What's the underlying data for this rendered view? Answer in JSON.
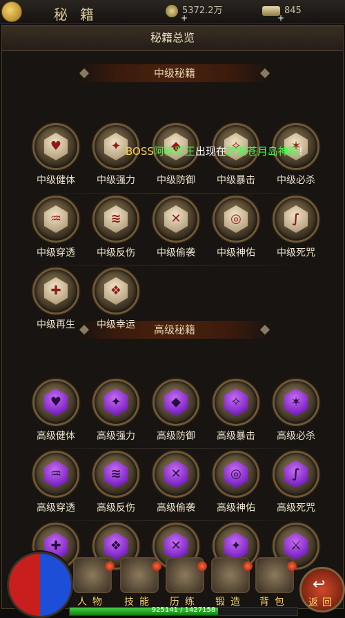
{
  "topbar": {
    "title": "秘籍",
    "gold": "5372.2万",
    "ingot": "845",
    "plus": "+"
  },
  "panel": {
    "header": "秘籍总览"
  },
  "sections": {
    "mid": "中级秘籍",
    "adv": "高级秘籍"
  },
  "mid_items": [
    {
      "label": "中级健体",
      "glyph": "♥"
    },
    {
      "label": "中级强力",
      "glyph": "✦"
    },
    {
      "label": "中级防御",
      "glyph": "◆"
    },
    {
      "label": "中级暴击",
      "glyph": "✧"
    },
    {
      "label": "中级必杀",
      "glyph": "✶"
    },
    {
      "label": "中级穿透",
      "glyph": "♒"
    },
    {
      "label": "中级反伤",
      "glyph": "≋"
    },
    {
      "label": "中级偷袭",
      "glyph": "✕"
    },
    {
      "label": "中级神佑",
      "glyph": "◎"
    },
    {
      "label": "中级死咒",
      "glyph": "∫"
    },
    {
      "label": "中级再生",
      "glyph": "✚"
    },
    {
      "label": "中级幸运",
      "glyph": "❖"
    }
  ],
  "adv_items": [
    {
      "label": "高级健体",
      "glyph": "♥"
    },
    {
      "label": "高级强力",
      "glyph": "✦"
    },
    {
      "label": "高级防御",
      "glyph": "◆"
    },
    {
      "label": "高级暴击",
      "glyph": "✧"
    },
    {
      "label": "高级必杀",
      "glyph": "✶"
    },
    {
      "label": "高级穿透",
      "glyph": "♒"
    },
    {
      "label": "高级反伤",
      "glyph": "≋"
    },
    {
      "label": "高级偷袭",
      "glyph": "✕"
    },
    {
      "label": "高级神佑",
      "glyph": "◎"
    },
    {
      "label": "高级死咒",
      "glyph": "∫"
    },
    {
      "label": "",
      "glyph": "✚"
    },
    {
      "label": "",
      "glyph": "❖"
    },
    {
      "label": "",
      "glyph": "✕"
    },
    {
      "label": "",
      "glyph": "✦"
    },
    {
      "label": "",
      "glyph": "⚔"
    }
  ],
  "marquee": {
    "boss": "BOSS",
    "name": "阿修罗王",
    "mid": "出现在",
    "place": "跨服苍月岛神殿",
    "end": "!"
  },
  "bottom_nav": [
    {
      "label": "人物"
    },
    {
      "label": "技能"
    },
    {
      "label": "历练"
    },
    {
      "label": "锻造"
    },
    {
      "label": "背包"
    }
  ],
  "back_label": "返回",
  "exp": {
    "text": "925141 / 1427158",
    "progress": 0.65
  },
  "colors": {
    "mid_medal": "#b9a684",
    "adv_medal": "#7a22c2",
    "marquee_green": "#3cff44",
    "nav_gold": "#ffd86a"
  }
}
